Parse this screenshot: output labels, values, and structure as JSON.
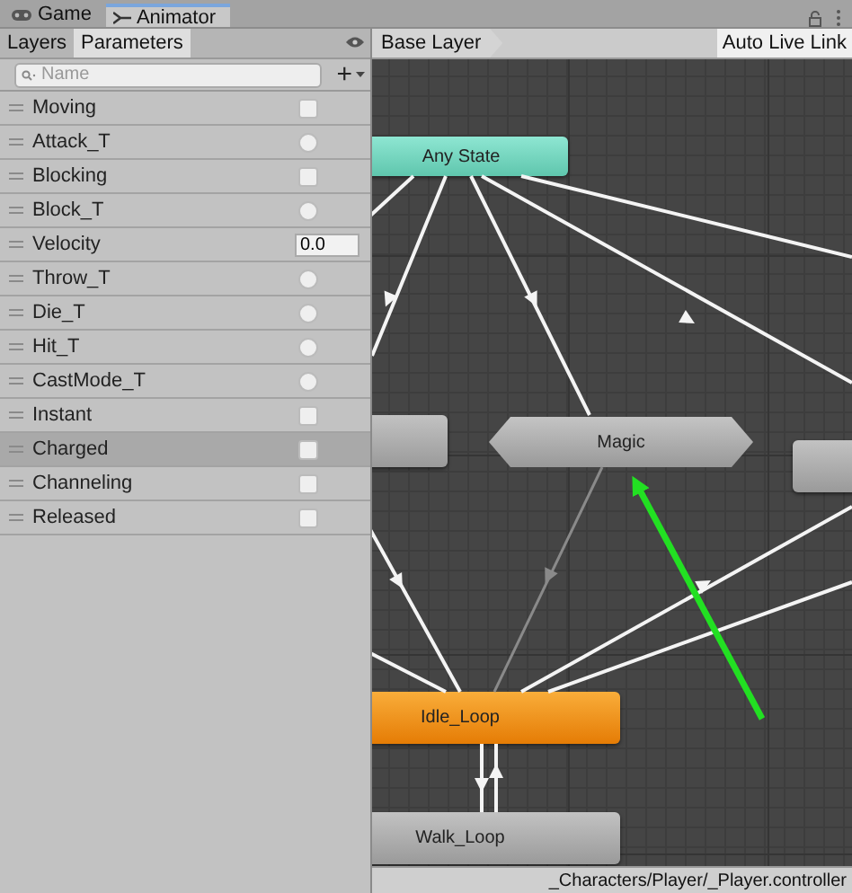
{
  "window_tabs": [
    {
      "label": "Game",
      "kind": "game",
      "selected": false
    },
    {
      "label": "Animator",
      "kind": "animator",
      "selected": true
    }
  ],
  "panel_tabs": [
    {
      "label": "Layers",
      "selected": false
    },
    {
      "label": "Parameters",
      "selected": true
    }
  ],
  "search": {
    "placeholder": "Name"
  },
  "add_button": "+",
  "parameters": [
    {
      "name": "Moving",
      "kind": "bool",
      "checked": false,
      "selected": false
    },
    {
      "name": "Attack_T",
      "kind": "trigger",
      "selected": false
    },
    {
      "name": "Blocking",
      "kind": "bool",
      "checked": false,
      "selected": false
    },
    {
      "name": "Block_T",
      "kind": "trigger",
      "selected": false
    },
    {
      "name": "Velocity",
      "kind": "float",
      "value": "0.0",
      "selected": false
    },
    {
      "name": "Throw_T",
      "kind": "trigger",
      "selected": false
    },
    {
      "name": "Die_T",
      "kind": "trigger",
      "selected": false
    },
    {
      "name": "Hit_T",
      "kind": "trigger",
      "selected": false
    },
    {
      "name": "CastMode_T",
      "kind": "trigger",
      "selected": false
    },
    {
      "name": "Instant",
      "kind": "bool",
      "checked": false,
      "selected": false
    },
    {
      "name": "Charged",
      "kind": "bool",
      "checked": false,
      "selected": true
    },
    {
      "name": "Channeling",
      "kind": "bool",
      "checked": false,
      "selected": false
    },
    {
      "name": "Released",
      "kind": "bool",
      "checked": false,
      "selected": false
    }
  ],
  "breadcrumb": "Base Layer",
  "auto_live_link": "Auto Live Link",
  "graph": {
    "nodes": [
      {
        "label": "Any State",
        "kind": "any"
      },
      {
        "label": "Magic",
        "kind": "substate"
      },
      {
        "kind": "state"
      },
      {
        "kind": "state"
      },
      {
        "label": "Idle_Loop",
        "kind": "default"
      },
      {
        "label": "Walk_Loop",
        "kind": "state"
      }
    ]
  },
  "status_bar": "_Characters/Player/_Player.controller"
}
